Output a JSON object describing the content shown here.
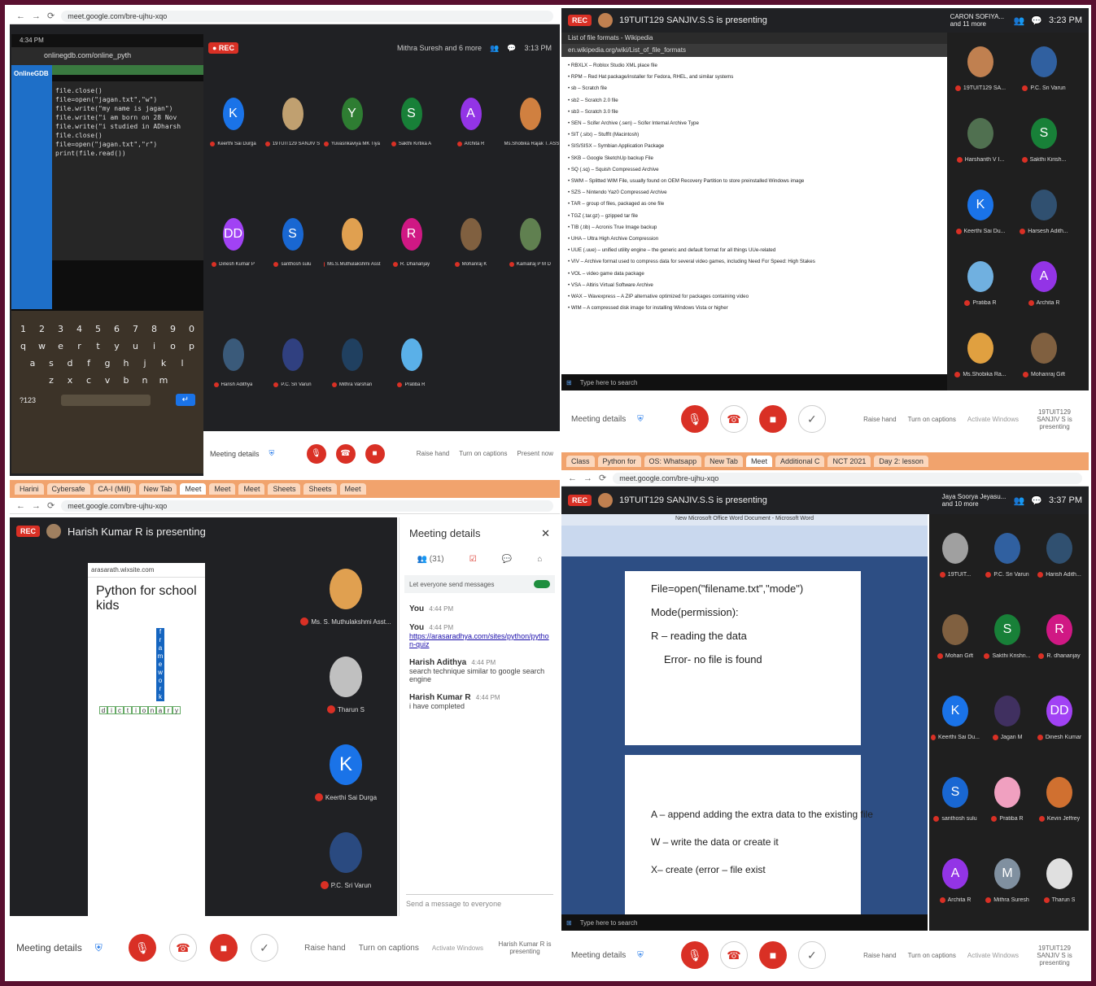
{
  "q1": {
    "browser_url": "meet.google.com/bre-ujhu-xqo",
    "phone": {
      "status_time": "4:34 PM",
      "url": "onlinegdb.com/online_pyth",
      "sidebar_brand": "OnlineGDB",
      "code_lines": [
        "file.close()",
        "file=open(\"jagan.txt\",\"w\")",
        "file.write(\"my name is jagan\")",
        "file.write(\"i am born on 28 Nov",
        "file.write(\"i studied in ADharsh",
        "file.close()",
        "file=open(\"jagan.txt\",\"r\")",
        "print(file.read())"
      ],
      "keyboard_row1": [
        "1",
        "2",
        "3",
        "4",
        "5",
        "6",
        "7",
        "8",
        "9",
        "0"
      ],
      "keyboard_row2": [
        "q",
        "w",
        "e",
        "r",
        "t",
        "y",
        "u",
        "i",
        "o",
        "p"
      ],
      "keyboard_row3": [
        "a",
        "s",
        "d",
        "f",
        "g",
        "h",
        "j",
        "k",
        "l"
      ],
      "keyboard_row4": [
        "z",
        "x",
        "c",
        "v",
        "b",
        "n",
        "m"
      ],
      "keyboard_left_key": "?123",
      "keyboard_enter_key": "↵"
    },
    "top_time": "3:13 PM",
    "presenter_short": "Mithra Suresh and 6 more",
    "participants": [
      {
        "initial": "K",
        "color": "#1a73e8",
        "name": "Keerthi Sai Durga"
      },
      {
        "initial": "",
        "color": "#c0a070",
        "name": "19TUIT129 SANJIV S"
      },
      {
        "initial": "Y",
        "color": "#2e7d32",
        "name": "Yuvasrikaviya MK Tiya"
      },
      {
        "initial": "S",
        "color": "#188038",
        "name": "Sakthi Kirtika A"
      },
      {
        "initial": "A",
        "color": "#9334e6",
        "name": "Archita R"
      },
      {
        "initial": "",
        "color": "#d08040",
        "name": "Ms.Shobika Rajak T. ASST.P"
      },
      {
        "initial": "DD",
        "color": "#a142f4",
        "name": "Dinesh Kumar P"
      },
      {
        "initial": "S",
        "color": "#1967d2",
        "name": "santhosh sulu"
      },
      {
        "initial": "",
        "color": "#e0a050",
        "name": "Ms.S.Muthulakshmi Asst"
      },
      {
        "initial": "R",
        "color": "#d01884",
        "name": "R. Dhananjay"
      },
      {
        "initial": "",
        "color": "#806040",
        "name": "Mohanraj K"
      },
      {
        "initial": "",
        "color": "#608050",
        "name": "Kamalraj P M D"
      },
      {
        "initial": "",
        "color": "#3a5a7a",
        "name": "Harish Adithya"
      },
      {
        "initial": "",
        "color": "#304080",
        "name": "P.C. Sri Varun"
      },
      {
        "initial": "",
        "color": "#204060",
        "name": "Mithra Varshan"
      },
      {
        "initial": "",
        "color": "#5ab0e8",
        "name": "Pratiba R"
      }
    ],
    "meeting_details": "Meeting details",
    "raise_hand": "Raise hand",
    "turn_on_captions": "Turn on captions",
    "present_now": "Present now"
  },
  "q2": {
    "rec": "REC",
    "presenting": "19TUIT129 SANJIV.S.S is presenting",
    "presenter_corner": "CARON SOFIYA... and 11 more",
    "time": "3:23 PM",
    "browser_url": "en.wikipedia.org/wiki/List_of_file_formats",
    "tab_label": "List of file formats - Wikipedia",
    "wiki_lines": [
      "• RBXLX – Roblox Studio XML place file",
      "• RPM – Red Hat package/installer for Fedora, RHEL, and similar systems",
      "• sb – Scratch file",
      "• sb2 – Scratch 2.0 file",
      "• sb3 – Scratch 3.0 file",
      "• SEN – Scifer Archive (.sen) – Scifer Internal Archive Type",
      "• SIT (.sitx) – StuffIt (Macintosh)",
      "• SIS/SISX – Symbian Application Package",
      "• SKB – Google SketchUp backup File",
      "• SQ (.sq) – Squish Compressed Archive",
      "• SWM – Splitted WIM File, usually found on OEM Recovery Partition to store preinstalled Windows image",
      "• SZS – Nintendo Yaz0 Compressed Archive",
      "• TAR – group of files, packaged as one file",
      "• TGZ (.tar.gz) – gzipped tar file",
      "• TIB (.tib) – Acronis True Image backup",
      "• UHA – Ultra High Archive Compression",
      "• UUE (.uue) – unified utility engine – the generic and default format for all things UUe-related",
      "• VIV – Archive format used to compress data for several video games, including Need For Speed: High Stakes",
      "• VOL – video game data package",
      "• VSA – Altiris Virtual Software Archive",
      "• WAX – Wavexpress – A ZIP alternative optimized for packages containing video",
      "• WIM – A compressed disk image for installing Windows Vista or higher"
    ],
    "taskbar_search": "Type here to search",
    "side": [
      {
        "initial": "",
        "color": "#c08050",
        "name": "19TUIT129 SA..."
      },
      {
        "initial": "",
        "color": "#3060a0",
        "name": "P.C. Sri Varun"
      },
      {
        "initial": "",
        "color": "#507050",
        "name": "Harshanth V I..."
      },
      {
        "initial": "S",
        "color": "#188038",
        "name": "Sakthi Kirish..."
      },
      {
        "initial": "K",
        "color": "#1a73e8",
        "name": "Keerthi Sai Du..."
      },
      {
        "initial": "",
        "color": "#305070",
        "name": "Harsesh Adith..."
      },
      {
        "initial": "",
        "color": "#70b0e0",
        "name": "Pratiba R"
      },
      {
        "initial": "A",
        "color": "#9334e6",
        "name": "Archita R"
      },
      {
        "initial": "",
        "color": "#e0a040",
        "name": "Ms.Shobika Ra..."
      },
      {
        "initial": "",
        "color": "#806040",
        "name": "Mohanraj Gift"
      }
    ],
    "meeting_details": "Meeting details",
    "raise_hand": "Raise hand",
    "turn_on_captions": "Turn on captions",
    "activate": "Activate Windows",
    "presenting_small": "19TUIT129 SANJIV S is presenting"
  },
  "q3": {
    "tabs": [
      "Harini",
      "Cybersafe",
      "CA-I (Mill)",
      "New Tab",
      "Meet",
      "Meet",
      "Meet",
      "Sheets",
      "Sheets",
      "Meet"
    ],
    "browser_url": "meet.google.com/bre-ujhu-xqo",
    "rec": "REC",
    "presenting": "Harish Kumar R is presenting",
    "phone_url": "arasarath.wixsite.com",
    "puzzle_title": "Python for school kids",
    "puzzle_cells_dictionary": [
      "d",
      "i",
      "c",
      "t",
      "i",
      "o",
      "n",
      "a",
      "r",
      "y"
    ],
    "puzzle_cells_framework": [
      "f",
      "r",
      "a",
      "m",
      "e",
      "w",
      "o",
      "r",
      "k"
    ],
    "side": [
      {
        "initial": "",
        "color": "#e0a050",
        "name": "Ms. S. Muthulakshmi Asst..."
      },
      {
        "initial": "",
        "color": "#c0c0c0",
        "name": "Tharun S"
      },
      {
        "initial": "K",
        "color": "#1a73e8",
        "name": "Keerthi Sai Durga"
      },
      {
        "initial": "",
        "color": "#2a4a80",
        "name": "P.C. Sri Varun"
      }
    ],
    "panel_title": "Meeting details",
    "panel_people": "(31)",
    "panel_toggle_label": "Let everyone send messages",
    "chat": [
      {
        "who": "You",
        "time": "4:44 PM",
        "text": ""
      },
      {
        "who": "You",
        "time": "4:44 PM",
        "text": "https://arasaradhya.com/sites/python/python-quiz"
      },
      {
        "who": "Harish Adithya",
        "time": "4:44 PM",
        "text": "search technique similar to google search engine"
      },
      {
        "who": "Harish Kumar R",
        "time": "4:44 PM",
        "text": "i have completed"
      }
    ],
    "chat_input": "Send a message to everyone",
    "meeting_details": "Meeting details",
    "raise_hand": "Raise hand",
    "turn_on_captions": "Turn on captions",
    "activate": "Activate Windows",
    "presenting_small": "Harish Kumar R is presenting"
  },
  "q4": {
    "tabs": [
      "Class",
      "Python for",
      "OS: Whatsapp",
      "New Tab",
      "Meet",
      "Additional C",
      "NCT 2021",
      "Day 2: lesson"
    ],
    "browser_url": "meet.google.com/bre-ujhu-xqo",
    "rec": "REC",
    "presenting": "19TUIT129 SANJIV.S.S is presenting",
    "presenter_corner": "Jaya Soorya Jeyasu... and 10 more",
    "time": "3:37 PM",
    "word_title": "New Microsoft Office Word Document - Microsoft Word",
    "page1": [
      "File=open(\"filename.txt\",\"mode\")",
      "Mode(permission):",
      "R – reading the data",
      "Error- no file is found"
    ],
    "page2": [
      "A – append adding the extra data to the existing file",
      "W – write the data or create it",
      "X– create (error – file exist"
    ],
    "side": [
      {
        "initial": "",
        "color": "#a0a0a0",
        "name": "19TUIT..."
      },
      {
        "initial": "",
        "color": "#3060a0",
        "name": "P.C. Sri Varun"
      },
      {
        "initial": "",
        "color": "#305070",
        "name": "Harish Adith..."
      },
      {
        "initial": "",
        "color": "#806040",
        "name": "Mohan Gift"
      },
      {
        "initial": "S",
        "color": "#188038",
        "name": "Sakthi Krishn..."
      },
      {
        "initial": "R",
        "color": "#d01884",
        "name": "R. dhananjay"
      },
      {
        "initial": "K",
        "color": "#1a73e8",
        "name": "Keerthi Sai Du..."
      },
      {
        "initial": "",
        "color": "#403060",
        "name": "Jagan M"
      },
      {
        "initial": "DD",
        "color": "#a142f4",
        "name": "Dinesh Kumar"
      },
      {
        "initial": "S",
        "color": "#1967d2",
        "name": "santhosh sulu"
      },
      {
        "initial": "",
        "color": "#f0a0c0",
        "name": "Pratiba R"
      },
      {
        "initial": "",
        "color": "#d07030",
        "name": "Kevin Jeffrey"
      },
      {
        "initial": "A",
        "color": "#9334e6",
        "name": "Archita R"
      },
      {
        "initial": "M",
        "color": "#8090a0",
        "name": "Mithra Suresh"
      },
      {
        "initial": "",
        "color": "#e0e0e0",
        "name": "Tharun S"
      }
    ],
    "taskbar_search": "Type here to search",
    "meeting_details": "Meeting details",
    "raise_hand": "Raise hand",
    "turn_on_captions": "Turn on captions",
    "activate": "Activate Windows",
    "presenting_small": "19TUIT129 SANJIV S is presenting"
  }
}
